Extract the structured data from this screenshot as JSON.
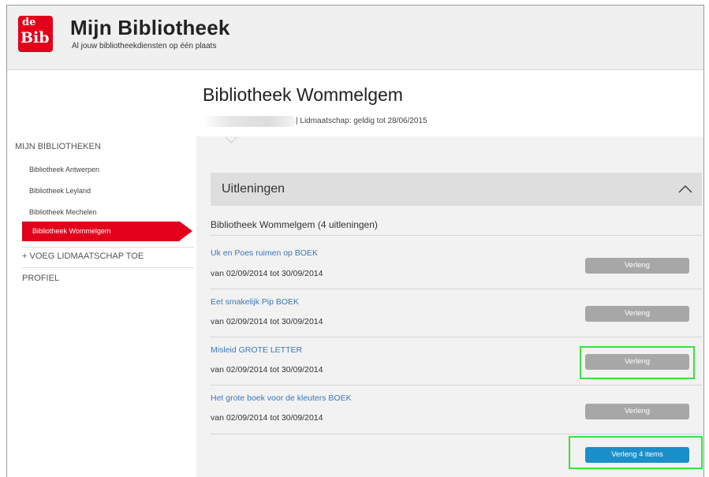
{
  "header": {
    "logo_top": "de",
    "logo_bottom": "Bib",
    "title": "Mijn Bibliotheek",
    "tagline": "Al jouw bibliotheekdiensten op één plaats"
  },
  "sidebar": {
    "heading": "MIJN BIBLIOTHEKEN",
    "libraries": [
      {
        "label": "Bibliotheek Antwerpen"
      },
      {
        "label": "Bibliotheek Leyland"
      },
      {
        "label": "Bibliotheek Mechelen"
      },
      {
        "label": "Bibliotheek Wommelgem",
        "active": true
      }
    ],
    "add_membership": "+ VOEG LIDMAATSCHAP TOE",
    "profile": "PROFIEL"
  },
  "main": {
    "library_title": "Bibliotheek Wommelgem",
    "membership": "| Lidmaatschap: geldig tot 28/06/2015",
    "section_title": "Uitleningen",
    "subheading": "Bibliotheek Wommelgem (4 uitleningen)",
    "loans": [
      {
        "title": "Uk en Poes ruimen op BOEK",
        "period": "van 02/09/2014 tot 30/09/2014",
        "button": "Verleng"
      },
      {
        "title": "Eet smakelijk Pip BOEK",
        "period": "van 02/09/2014 tot 30/09/2014",
        "button": "Verleng"
      },
      {
        "title": "Misleid GROTE LETTER",
        "period": "van 02/09/2014 tot 30/09/2014",
        "button": "Verleng"
      },
      {
        "title": "Het grote boek voor de kleuters BOEK",
        "period": "van 02/09/2014 tot 30/09/2014",
        "button": "Verleng"
      }
    ],
    "renew_all": "Verleng 4 items"
  },
  "colors": {
    "brand_red": "#e2001a",
    "link_blue": "#3a78b8",
    "button_gray": "#a7a7a7",
    "button_blue": "#1a8fc9",
    "highlight_green": "#39e23c"
  }
}
